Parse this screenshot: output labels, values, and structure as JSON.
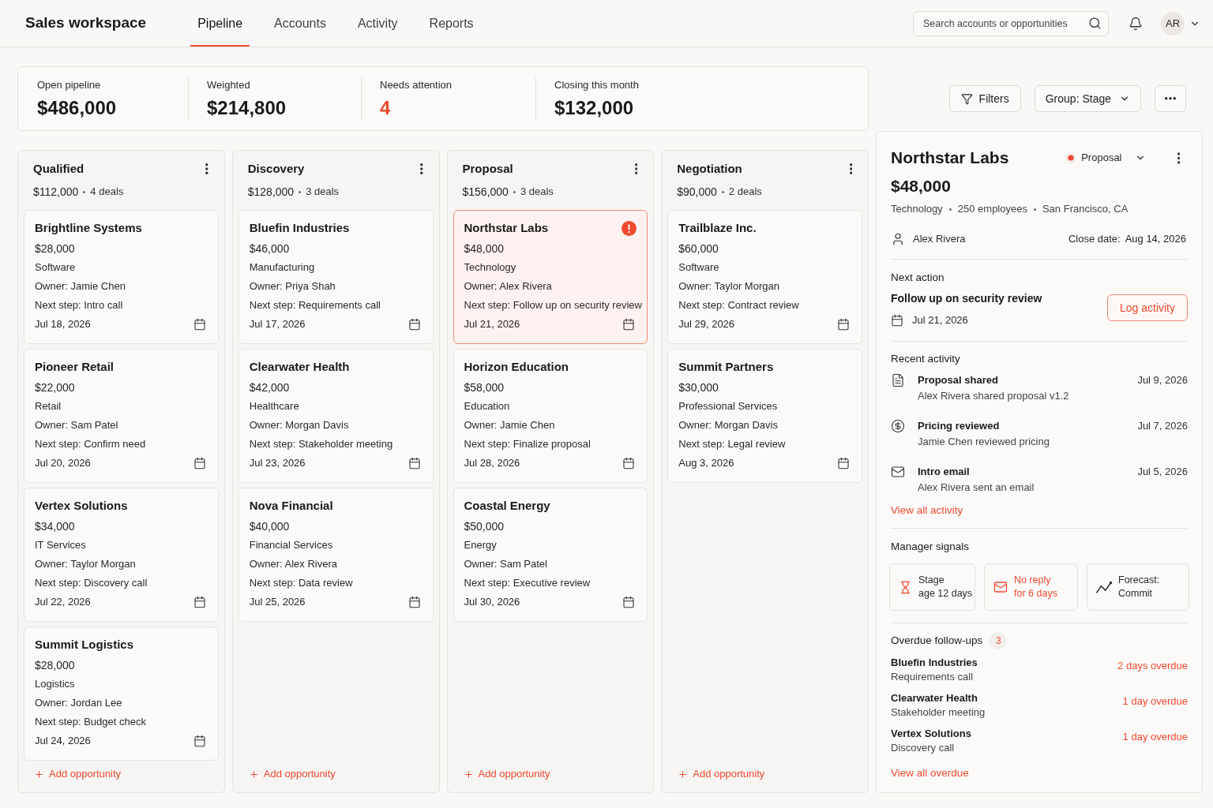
{
  "app": {
    "title": "Sales workspace"
  },
  "nav": [
    {
      "label": "Pipeline",
      "selected": true
    },
    {
      "label": "Accounts",
      "selected": false
    },
    {
      "label": "Activity",
      "selected": false
    },
    {
      "label": "Reports",
      "selected": false
    }
  ],
  "search": {
    "placeholder": "Search accounts or opportunities"
  },
  "user": {
    "initials": "AR"
  },
  "summary": [
    {
      "label": "Open pipeline",
      "value": "$486,000",
      "highlight": false
    },
    {
      "label": "Weighted",
      "value": "$214,800",
      "highlight": false
    },
    {
      "label": "Needs attention",
      "value": "4",
      "highlight": true
    },
    {
      "label": "Closing this month",
      "value": "$132,000",
      "highlight": false
    }
  ],
  "toolbar": {
    "filters": "Filters",
    "group": "Group: Stage"
  },
  "columns": [
    {
      "title": "Qualified",
      "total": "$112,000",
      "count": "4 deals",
      "add_label": "Add opportunity",
      "cards": [
        {
          "name": "Brightline Systems",
          "amount": "$28,000",
          "industry": "Software",
          "owner": "Owner: Jamie Chen",
          "next_step": "Next step: Intro call",
          "date": "Jul 18, 2026",
          "selected": false,
          "flagged": false
        },
        {
          "name": "Pioneer Retail",
          "amount": "$22,000",
          "industry": "Retail",
          "owner": "Owner: Sam Patel",
          "next_step": "Next step: Confirm need",
          "date": "Jul 20, 2026",
          "selected": false,
          "flagged": false
        },
        {
          "name": "Vertex Solutions",
          "amount": "$34,000",
          "industry": "IT Services",
          "owner": "Owner: Taylor Morgan",
          "next_step": "Next step: Discovery call",
          "date": "Jul 22, 2026",
          "selected": false,
          "flagged": false
        },
        {
          "name": "Summit Logistics",
          "amount": "$28,000",
          "industry": "Logistics",
          "owner": "Owner: Jordan Lee",
          "next_step": "Next step: Budget check",
          "date": "Jul 24, 2026",
          "selected": false,
          "flagged": false
        }
      ]
    },
    {
      "title": "Discovery",
      "total": "$128,000",
      "count": "3 deals",
      "add_label": "Add opportunity",
      "cards": [
        {
          "name": "Bluefin Industries",
          "amount": "$46,000",
          "industry": "Manufacturing",
          "owner": "Owner: Priya Shah",
          "next_step": "Next step: Requirements call",
          "date": "Jul 17, 2026",
          "selected": false,
          "flagged": false
        },
        {
          "name": "Clearwater Health",
          "amount": "$42,000",
          "industry": "Healthcare",
          "owner": "Owner: Morgan Davis",
          "next_step": "Next step: Stakeholder meeting",
          "date": "Jul 23, 2026",
          "selected": false,
          "flagged": false
        },
        {
          "name": "Nova Financial",
          "amount": "$40,000",
          "industry": "Financial Services",
          "owner": "Owner: Alex Rivera",
          "next_step": "Next step: Data review",
          "date": "Jul 25, 2026",
          "selected": false,
          "flagged": false
        }
      ]
    },
    {
      "title": "Proposal",
      "total": "$156,000",
      "count": "3 deals",
      "add_label": "Add opportunity",
      "cards": [
        {
          "name": "Northstar Labs",
          "amount": "$48,000",
          "industry": "Technology",
          "owner": "Owner: Alex Rivera",
          "next_step": "Next step: Follow up on security review",
          "date": "Jul 21, 2026",
          "selected": true,
          "flagged": true
        },
        {
          "name": "Horizon Education",
          "amount": "$58,000",
          "industry": "Education",
          "owner": "Owner: Jamie Chen",
          "next_step": "Next step: Finalize proposal",
          "date": "Jul 28, 2026",
          "selected": false,
          "flagged": false
        },
        {
          "name": "Coastal Energy",
          "amount": "$50,000",
          "industry": "Energy",
          "owner": "Owner: Sam Patel",
          "next_step": "Next step: Executive review",
          "date": "Jul 30, 2026",
          "selected": false,
          "flagged": false
        }
      ]
    },
    {
      "title": "Negotiation",
      "total": "$90,000",
      "count": "2 deals",
      "add_label": "Add opportunity",
      "cards": [
        {
          "name": "Trailblaze Inc.",
          "amount": "$60,000",
          "industry": "Software",
          "owner": "Owner: Taylor Morgan",
          "next_step": "Next step: Contract review",
          "date": "Jul 29, 2026",
          "selected": false,
          "flagged": false
        },
        {
          "name": "Summit Partners",
          "amount": "$30,000",
          "industry": "Professional Services",
          "owner": "Owner: Morgan Davis",
          "next_step": "Next step: Legal review",
          "date": "Aug 3, 2026",
          "selected": false,
          "flagged": false
        }
      ]
    }
  ],
  "detail": {
    "name": "Northstar Labs",
    "stage": "Proposal",
    "amount": "$48,000",
    "meta": [
      "Technology",
      "250 employees",
      "San Francisco, CA"
    ],
    "owner": "Alex Rivera",
    "close_label": "Close date:",
    "close_date": "Aug 14, 2026",
    "next_action": {
      "heading": "Next action",
      "title": "Follow up on security review",
      "date": "Jul 21, 2026",
      "button": "Log activity"
    },
    "recent_activity": {
      "heading": "Recent activity",
      "items": [
        {
          "kind": "document",
          "title": "Proposal shared",
          "detail": "Alex Rivera shared proposal v1.2",
          "date": "Jul 9, 2026"
        },
        {
          "kind": "payment",
          "title": "Pricing reviewed",
          "detail": "Jamie Chen reviewed pricing",
          "date": "Jul 7, 2026"
        },
        {
          "kind": "email",
          "title": "Intro email",
          "detail": "Alex Rivera sent an email",
          "date": "Jul 5, 2026"
        }
      ],
      "link": "View all activity"
    },
    "signals": {
      "heading": "Manager signals",
      "items": [
        {
          "kind": "stage_age",
          "lines": [
            "Stage",
            "age 12 days"
          ]
        },
        {
          "kind": "no_reply",
          "lines": [
            "No reply",
            "for 6 days"
          ]
        },
        {
          "kind": "forecast",
          "lines": [
            "Forecast:",
            "Commit"
          ]
        }
      ]
    },
    "overdue": {
      "heading": "Overdue follow-ups",
      "count": "3",
      "items": [
        {
          "name": "Bluefin Industries",
          "task": "Requirements call",
          "status": "2 days overdue"
        },
        {
          "name": "Clearwater Health",
          "task": "Stakeholder meeting",
          "status": "1 day overdue"
        },
        {
          "name": "Vertex Solutions",
          "task": "Discovery call",
          "status": "1 day overdue"
        }
      ],
      "link": "View all overdue"
    }
  }
}
